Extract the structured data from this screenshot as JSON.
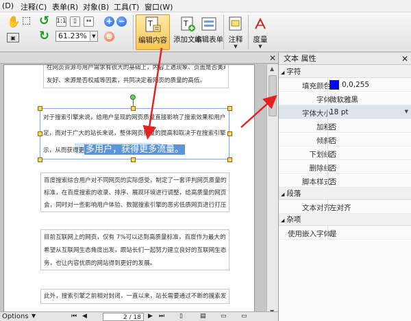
{
  "menu": [
    {
      "label": "(D)"
    },
    {
      "label": "注释(C)"
    },
    {
      "label": "表单(R)"
    },
    {
      "label": "对象(B)"
    },
    {
      "label": "工具(T)"
    },
    {
      "label": "窗口(W)"
    }
  ],
  "toolbar": {
    "zoom_value": "61.23%",
    "edit_content": "编辑内容",
    "add_text": "添加文本",
    "edit_form": "编辑表单",
    "annotate": "注释",
    "stamp": "度量"
  },
  "document": {
    "paragraphs": [
      {
        "lines": [
          "在网页资源与用户需求有很大的基础上，内容上遇现象、页面是否美观、对用户是否",
          "友好、来源是否权威等因素，共同决定着网页的质量的高低。"
        ]
      },
      {
        "lines": [
          "对于搜索引擎来说，给用户呈现的网页质量直接影响了搜索效果和用户的需求满",
          "足，而对于广大的站长来说，整体网页质量的提高和取决于在搜索引擎获得良好的排序和展",
          "示，从而获得更"
        ],
        "highlight": "多用户，获得更多流量。"
      },
      {
        "lines": [
          "百度搜索综合用户对不同网页的实际感受，制定了一套评判网页质量的标准，基于这个",
          "标准，在百度搜索的收录、排序、展现环境进行调整，给高质量的网页更多的收录、展现机",
          "会，同时对一些影响用户体验、数据搜索引擎的恶劣低质网页进行打压。"
        ]
      },
      {
        "lines": [
          "目前互联网上的网页，仅有 7%可以达到高质量标准，百度作为最大的中文搜索引擎，",
          "希望从互联网生态角度出发，跟站长们一起努力建立良好的互联网生态圈，更好地为网民服",
          "务，也让内容优质的网站得到更好的发展。"
        ]
      },
      {
        "lines": [
          "此外，搜索引擎之前相对封闭，一直以来，站长需要通过不断的摸索发现搜索引擎对网"
        ]
      }
    ]
  },
  "status": {
    "options_label": "Options",
    "page_indicator": "2 / 18"
  },
  "panel": {
    "title": "文本 属性",
    "sections": [
      {
        "name": "字符",
        "rows": [
          {
            "key": "填充颜色",
            "value": "0,0,255",
            "swatch": "#0000ff"
          },
          {
            "key": "字体",
            "value": "微软雅黑"
          },
          {
            "key": "字体大小",
            "value": "18 pt"
          },
          {
            "key": "加粗",
            "value": "否"
          },
          {
            "key": "倾斜",
            "value": "否"
          },
          {
            "key": "下划线",
            "value": "否"
          },
          {
            "key": "删除线",
            "value": "否"
          },
          {
            "key": "脚本样式",
            "value": "否"
          }
        ]
      },
      {
        "name": "段落",
        "rows": [
          {
            "key": "文本对齐",
            "value": "左对齐"
          }
        ]
      },
      {
        "name": "杂项",
        "rows": [
          {
            "key": "使用嵌入字体",
            "value": "是"
          }
        ]
      }
    ]
  },
  "colors": {
    "selection": "#5d95d8",
    "active_button": "#f8c652",
    "annotation_arrow": "#e52222"
  }
}
